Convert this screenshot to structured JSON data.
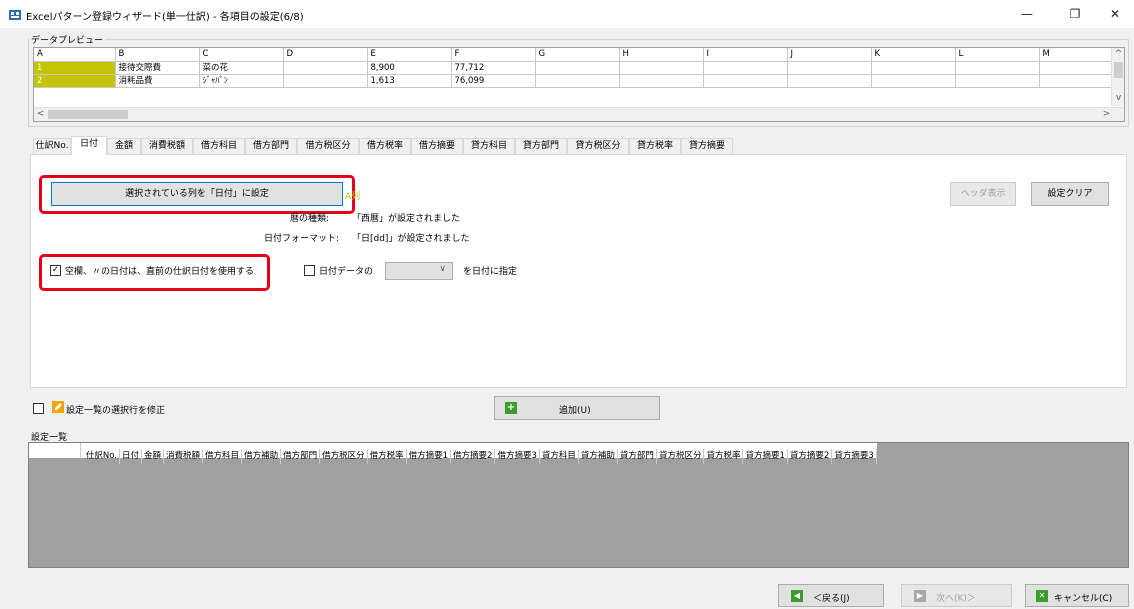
{
  "window": {
    "title": "Excelパターン登録ウィザード(単一仕訳) - 各項目の設定(6/8)",
    "minimize": "—",
    "maximize": "❐",
    "close": "✕"
  },
  "preview": {
    "label": "データプレビュー",
    "columns": [
      "A",
      "B",
      "C",
      "D",
      "E",
      "F",
      "G",
      "H",
      "I",
      "J",
      "K",
      "L",
      "M"
    ],
    "rows": [
      [
        "1",
        "接待交際費",
        "菜の花",
        "",
        "8,900",
        "77,712",
        "",
        "",
        "",
        "",
        "",
        "",
        ""
      ],
      [
        "2",
        "消耗品費",
        "ｼﾞｬﾊﾟﾝ",
        "",
        "1,613",
        "76,099",
        "",
        "",
        "",
        "",
        "",
        "",
        ""
      ]
    ]
  },
  "tabs": [
    "仕訳No.",
    "日付",
    "金額",
    "消費税額",
    "借方科目",
    "借方部門",
    "借方税区分",
    "借方税率",
    "借方摘要",
    "貸方科目",
    "貸方部門",
    "貸方税区分",
    "貸方税率",
    "貸方摘要"
  ],
  "active_tab": "日付",
  "panel": {
    "set_column_button": "選択されている列を「日付」に設定",
    "column_indicator": "A列",
    "calendar_label": "暦の種類:",
    "calendar_value": "「西暦」が設定されました",
    "format_label": "日付フォーマット:",
    "format_value": "「日[dd]」が設定されました",
    "header_button": "ヘッダ表示",
    "clear_button": "設定クリア",
    "blank_date_checkbox": "空欄、〃の日付は、直前の仕訳日付を使用する",
    "blank_date_checked": true,
    "date_data_checkbox": "日付データの",
    "date_data_checked": false,
    "date_data_suffix": "を日付に指定",
    "date_data_combo_value": ""
  },
  "modify_checkbox": "設定一覧の選択行を修正",
  "add_button": "追加(U)",
  "settings_list": {
    "label": "設定一覧",
    "columns": [
      "仕訳No.",
      "日付",
      "金額",
      "消費税額",
      "借方科目",
      "借方補助",
      "借方部門",
      "借方税区分",
      "借方税率",
      "借方摘要1",
      "借方摘要2",
      "借方摘要3",
      "貸方科目",
      "貸方補助",
      "貸方部門",
      "貸方税区分",
      "貸方税率",
      "貸方摘要1",
      "貸方摘要2",
      "貸方摘要3"
    ]
  },
  "footer": {
    "back_button": "＜戻る(J)",
    "next_button": "次へ(K)＞",
    "cancel_button": "キャンセル(C)"
  },
  "colors": {
    "highlight_frame": "#e2001a",
    "selected_cell": "#c4c400",
    "column_indicator": "#c4c400"
  }
}
